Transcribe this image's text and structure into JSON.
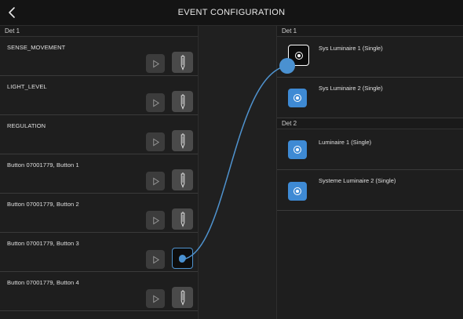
{
  "header": {
    "title": "EVENT CONFIGURATION",
    "back_icon": "chevron-left-icon"
  },
  "sources": {
    "group_label": "Det 1",
    "items": [
      {
        "label": "SENSE_MOVEMENT",
        "connected": false
      },
      {
        "label": "LIGHT_LEVEL",
        "connected": false
      },
      {
        "label": "REGULATION",
        "connected": false
      },
      {
        "label": "Button 07001779, Button 1",
        "connected": false
      },
      {
        "label": "Button 07001779, Button 2",
        "connected": false
      },
      {
        "label": "Button 07001779, Button 3",
        "connected": true
      },
      {
        "label": "Button 07001779, Button 4",
        "connected": false
      }
    ]
  },
  "targets": {
    "groups": [
      {
        "label": "Det 1",
        "items": [
          {
            "label": "Sys Luminaire 1 (Single)",
            "connected": true
          },
          {
            "label": "Sys Luminaire 2 (Single)",
            "connected": false
          }
        ]
      },
      {
        "label": "Det 2",
        "items": [
          {
            "label": "Luminaire 1 (Single)",
            "connected": false
          },
          {
            "label": "Systeme Luminaire 2 (Single)",
            "connected": false
          }
        ]
      }
    ]
  },
  "connection": {
    "from": "Button 07001779, Button 3",
    "to": "Sys Luminaire 1 (Single)",
    "color": "#4f93cf"
  }
}
